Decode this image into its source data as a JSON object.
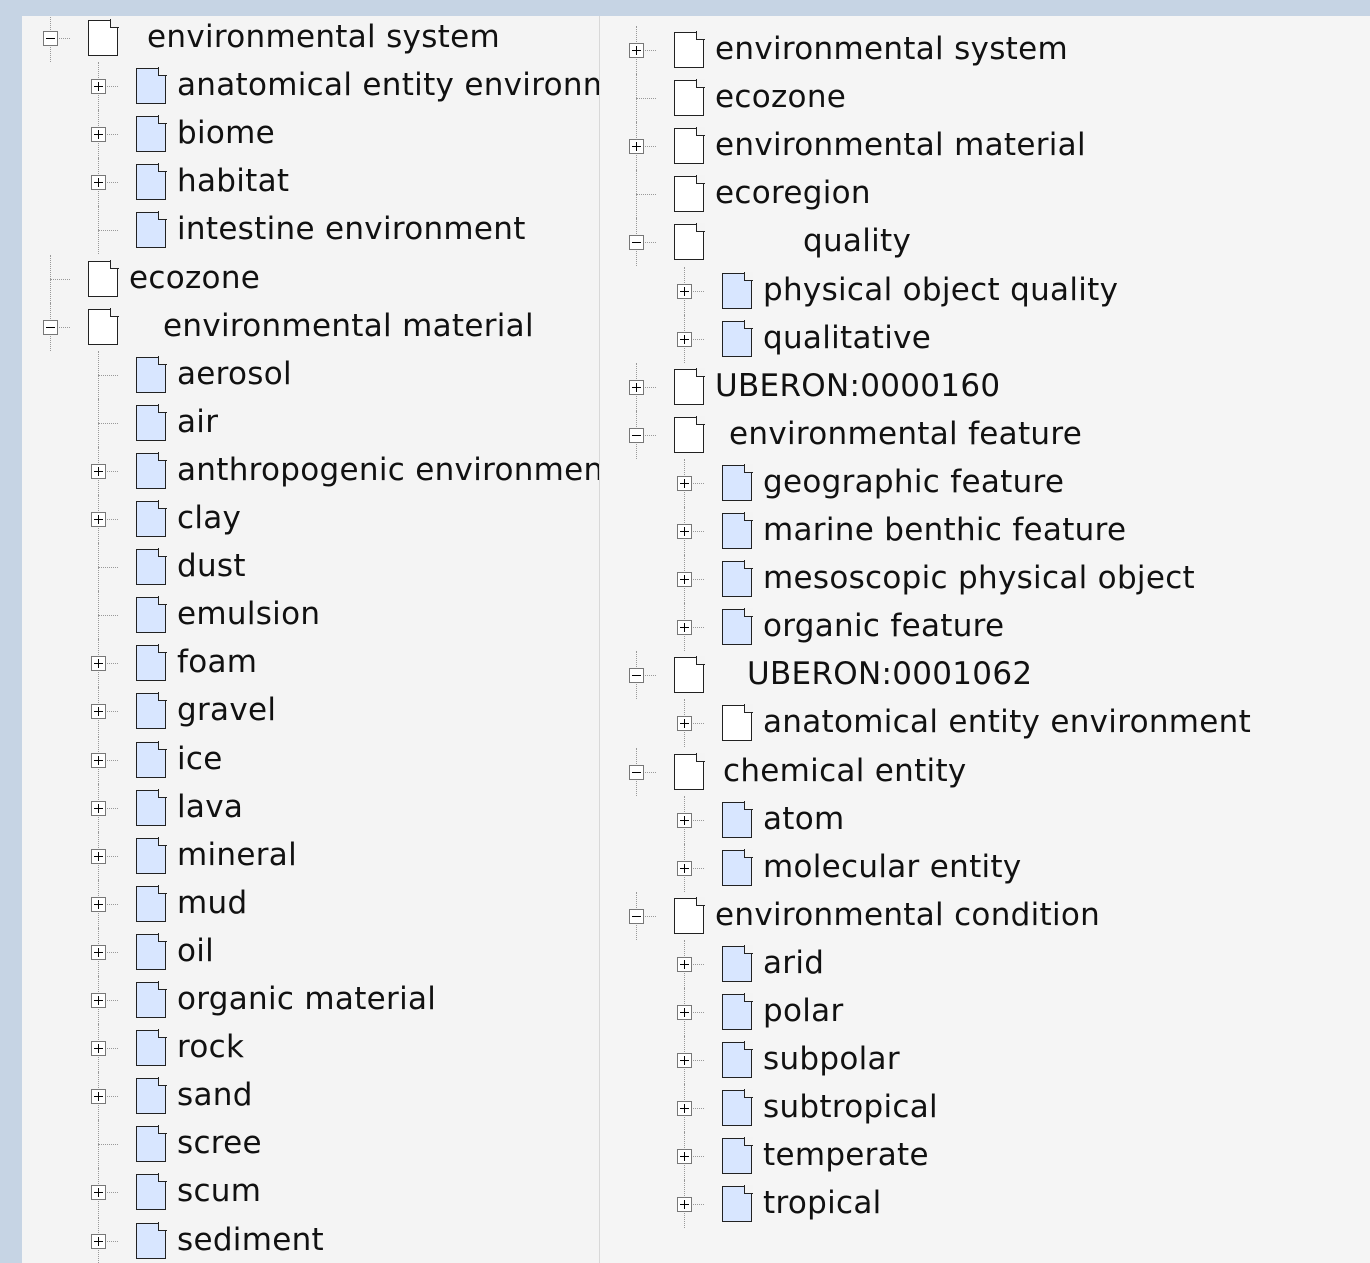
{
  "left_tree": [
    {
      "label": "environmental system",
      "toggle": "minus",
      "level": 0,
      "color": "white"
    },
    {
      "label": "anatomical entity environment",
      "toggle": "plus",
      "level": 1,
      "color": "blue"
    },
    {
      "label": "biome",
      "toggle": "plus",
      "level": 1,
      "color": "blue"
    },
    {
      "label": "habitat",
      "toggle": "plus",
      "level": 1,
      "color": "blue"
    },
    {
      "label": "intestine environment",
      "toggle": "none",
      "level": 1,
      "color": "blue"
    },
    {
      "label": "ecozone",
      "toggle": "none",
      "level": 0,
      "color": "white"
    },
    {
      "label": "environmental material",
      "toggle": "minus",
      "level": 0,
      "color": "white"
    },
    {
      "label": "aerosol",
      "toggle": "none",
      "level": 1,
      "color": "blue"
    },
    {
      "label": "air",
      "toggle": "none",
      "level": 1,
      "color": "blue"
    },
    {
      "label": "anthropogenic environmental material",
      "toggle": "plus",
      "level": 1,
      "color": "blue"
    },
    {
      "label": "clay",
      "toggle": "plus",
      "level": 1,
      "color": "blue"
    },
    {
      "label": "dust",
      "toggle": "none",
      "level": 1,
      "color": "blue"
    },
    {
      "label": "emulsion",
      "toggle": "none",
      "level": 1,
      "color": "blue"
    },
    {
      "label": "foam",
      "toggle": "plus",
      "level": 1,
      "color": "blue"
    },
    {
      "label": "gravel",
      "toggle": "plus",
      "level": 1,
      "color": "blue"
    },
    {
      "label": "ice",
      "toggle": "plus",
      "level": 1,
      "color": "blue"
    },
    {
      "label": "lava",
      "toggle": "plus",
      "level": 1,
      "color": "blue"
    },
    {
      "label": "mineral",
      "toggle": "plus",
      "level": 1,
      "color": "blue"
    },
    {
      "label": "mud",
      "toggle": "plus",
      "level": 1,
      "color": "blue"
    },
    {
      "label": "oil",
      "toggle": "plus",
      "level": 1,
      "color": "blue"
    },
    {
      "label": "organic material",
      "toggle": "plus",
      "level": 1,
      "color": "blue"
    },
    {
      "label": "rock",
      "toggle": "plus",
      "level": 1,
      "color": "blue"
    },
    {
      "label": "sand",
      "toggle": "plus",
      "level": 1,
      "color": "blue"
    },
    {
      "label": "scree",
      "toggle": "none",
      "level": 1,
      "color": "blue"
    },
    {
      "label": "scum",
      "toggle": "plus",
      "level": 1,
      "color": "blue"
    },
    {
      "label": "sediment",
      "toggle": "plus",
      "level": 1,
      "color": "blue"
    }
  ],
  "right_tree": [
    {
      "label": "environmental system",
      "toggle": "plus",
      "level": 0,
      "color": "white"
    },
    {
      "label": "ecozone",
      "toggle": "none",
      "level": 0,
      "color": "white"
    },
    {
      "label": "environmental material",
      "toggle": "plus",
      "level": 0,
      "color": "white"
    },
    {
      "label": "ecoregion",
      "toggle": "none",
      "level": 0,
      "color": "white"
    },
    {
      "label": "quality",
      "toggle": "minus",
      "level": 0,
      "color": "white"
    },
    {
      "label": "physical object quality",
      "toggle": "plus",
      "level": 1,
      "color": "blue"
    },
    {
      "label": "qualitative",
      "toggle": "plus",
      "level": 1,
      "color": "blue"
    },
    {
      "label": "UBERON:0000160",
      "toggle": "plus",
      "level": 0,
      "color": "white"
    },
    {
      "label": "environmental feature",
      "toggle": "minus",
      "level": 0,
      "color": "white"
    },
    {
      "label": "geographic feature",
      "toggle": "plus",
      "level": 1,
      "color": "blue"
    },
    {
      "label": "marine benthic feature",
      "toggle": "plus",
      "level": 1,
      "color": "blue"
    },
    {
      "label": "mesoscopic physical object",
      "toggle": "plus",
      "level": 1,
      "color": "blue"
    },
    {
      "label": "organic feature",
      "toggle": "plus",
      "level": 1,
      "color": "blue"
    },
    {
      "label": "UBERON:0001062",
      "toggle": "minus",
      "level": 0,
      "color": "white"
    },
    {
      "label": "anatomical entity environment",
      "toggle": "plus",
      "level": 1,
      "color": "white"
    },
    {
      "label": "chemical entity",
      "toggle": "minus",
      "level": 0,
      "color": "white"
    },
    {
      "label": "atom",
      "toggle": "plus",
      "level": 1,
      "color": "blue"
    },
    {
      "label": "molecular entity",
      "toggle": "plus",
      "level": 1,
      "color": "blue"
    },
    {
      "label": "environmental condition",
      "toggle": "minus",
      "level": 0,
      "color": "white"
    },
    {
      "label": "arid",
      "toggle": "plus",
      "level": 1,
      "color": "blue"
    },
    {
      "label": "polar",
      "toggle": "plus",
      "level": 1,
      "color": "blue"
    },
    {
      "label": "subpolar",
      "toggle": "plus",
      "level": 1,
      "color": "blue"
    },
    {
      "label": "subtropical",
      "toggle": "plus",
      "level": 1,
      "color": "blue"
    },
    {
      "label": "temperate",
      "toggle": "plus",
      "level": 1,
      "color": "blue"
    },
    {
      "label": "tropical",
      "toggle": "plus",
      "level": 1,
      "color": "blue"
    }
  ]
}
